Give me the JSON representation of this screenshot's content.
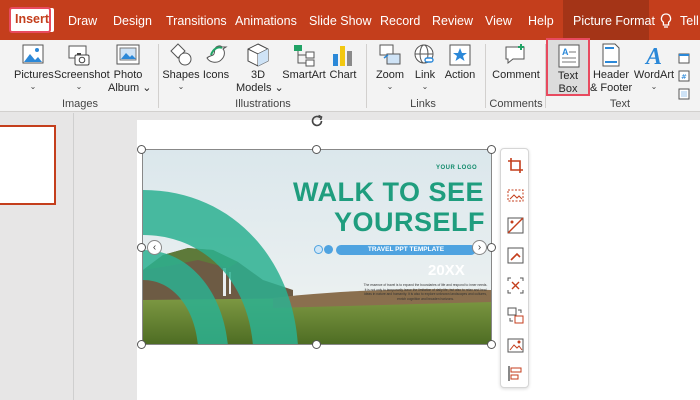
{
  "tabs": [
    {
      "label": "Insert"
    },
    {
      "label": "Draw"
    },
    {
      "label": "Design"
    },
    {
      "label": "Transitions"
    },
    {
      "label": "Animations"
    },
    {
      "label": "Slide Show"
    },
    {
      "label": "Record"
    },
    {
      "label": "Review"
    },
    {
      "label": "View"
    },
    {
      "label": "Help"
    },
    {
      "label": "Picture Format"
    },
    {
      "label": "Tell"
    }
  ],
  "ribbon": {
    "pictures": {
      "label": "Pictures",
      "icon": "pictures-icon"
    },
    "screenshot": {
      "label": "Screenshot",
      "icon": "camera-icon"
    },
    "photo_album": {
      "label1": "Photo",
      "label2": "Album",
      "icon": "photo-album-icon"
    },
    "shapes": {
      "label": "Shapes",
      "icon": "shapes-icon"
    },
    "icons": {
      "label": "Icons",
      "icon": "bird-icon"
    },
    "models_3d": {
      "label1": "3D",
      "label2": "Models",
      "icon": "cube-icon"
    },
    "smartart": {
      "label": "SmartArt",
      "icon": "smartart-icon"
    },
    "chart": {
      "label": "Chart",
      "icon": "chart-icon"
    },
    "zoom": {
      "label": "Zoom",
      "icon": "zoom-icon"
    },
    "link": {
      "label": "Link",
      "icon": "link-icon"
    },
    "action": {
      "label": "Action",
      "icon": "action-star-icon"
    },
    "comment": {
      "label": "Comment",
      "icon": "comment-icon"
    },
    "text_box": {
      "label1": "Text",
      "label2": "Box",
      "icon": "text-box-icon"
    },
    "header_footer": {
      "label1": "Header",
      "label2": "& Footer",
      "icon": "header-footer-icon"
    },
    "wordart": {
      "label": "WordArt",
      "icon": "wordart-icon"
    },
    "groups": {
      "images": "Images",
      "illustrations": "Illustrations",
      "links": "Links",
      "comments": "Comments",
      "text": "Text"
    }
  },
  "slide": {
    "logo": "YOUR LOGO",
    "title_line1": "WALK TO SEE",
    "title_line2": "YOURSELF",
    "subtitle": "TRAVEL PPT TEMPLATE",
    "year": "20XX",
    "paragraph": "The essence of travel is to expand the boundaries of life and respond to inner needs. It is not only to temporarily leave the limitation of daily life, but also to relax and heal ideas in nature and humanity. It is also to explore unknown landscapes and cultures, enrich cognition and broaden horizons."
  },
  "colors": {
    "accent": "#c43e1c",
    "highlight": "#e84a5f",
    "teal": "#1f9d7e",
    "blue": "#4fa3e0"
  }
}
